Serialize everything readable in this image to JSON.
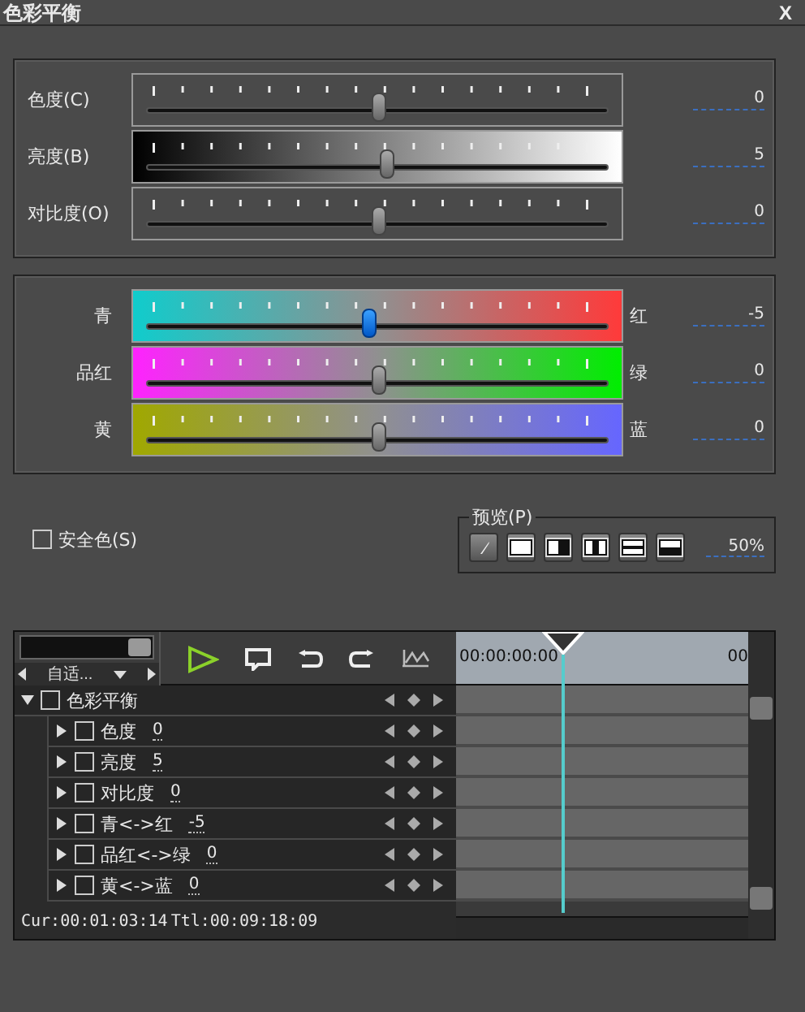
{
  "window": {
    "title": "色彩平衡",
    "close": "X"
  },
  "tone_sliders": [
    {
      "label": "色度(C)",
      "kind": "plain",
      "level": 0.5,
      "value": "0",
      "selected": false
    },
    {
      "label": "亮度(B)",
      "kind": "brightness",
      "level": 0.52,
      "value": "5",
      "selected": false
    },
    {
      "label": "对比度(O)",
      "kind": "plain",
      "level": 0.5,
      "value": "0",
      "selected": false
    }
  ],
  "color_sliders": [
    {
      "left": "青",
      "right": "红",
      "kind": "cyan",
      "level": 0.48,
      "value": "-5",
      "selected": true
    },
    {
      "left": "品红",
      "right": "绿",
      "kind": "magenta",
      "level": 0.5,
      "value": "0",
      "selected": false
    },
    {
      "left": "黄",
      "right": "蓝",
      "kind": "yellow",
      "level": 0.5,
      "value": "0",
      "selected": false
    }
  ],
  "safe_color": {
    "label": "安全色(S)",
    "checked": false
  },
  "preview": {
    "title": "预览(P)",
    "percent": "50%"
  },
  "timeline": {
    "zoom_slider": {
      "level": 0.9
    },
    "zoom": "自适...",
    "tree": [
      {
        "name": "色彩平衡",
        "checked": false,
        "expanded": true,
        "children": [
          {
            "name": "色度",
            "value": "0",
            "checked": false,
            "expanded": false
          },
          {
            "name": "亮度",
            "value": "5",
            "checked": false,
            "expanded": false
          },
          {
            "name": "对比度",
            "value": "0",
            "checked": false,
            "expanded": false
          },
          {
            "name": "青<->红",
            "value": "-5",
            "checked": false,
            "expanded": false
          },
          {
            "name": "品红<->绿",
            "value": "0",
            "checked": false,
            "expanded": false
          },
          {
            "name": "黄<->蓝",
            "value": "0",
            "checked": false,
            "expanded": false
          }
        ]
      }
    ],
    "current": "Cur:00:01:03:14",
    "total": "Ttl:00:09:18:09",
    "ruler_start": "00:00:00:00",
    "ruler_end": "00"
  }
}
